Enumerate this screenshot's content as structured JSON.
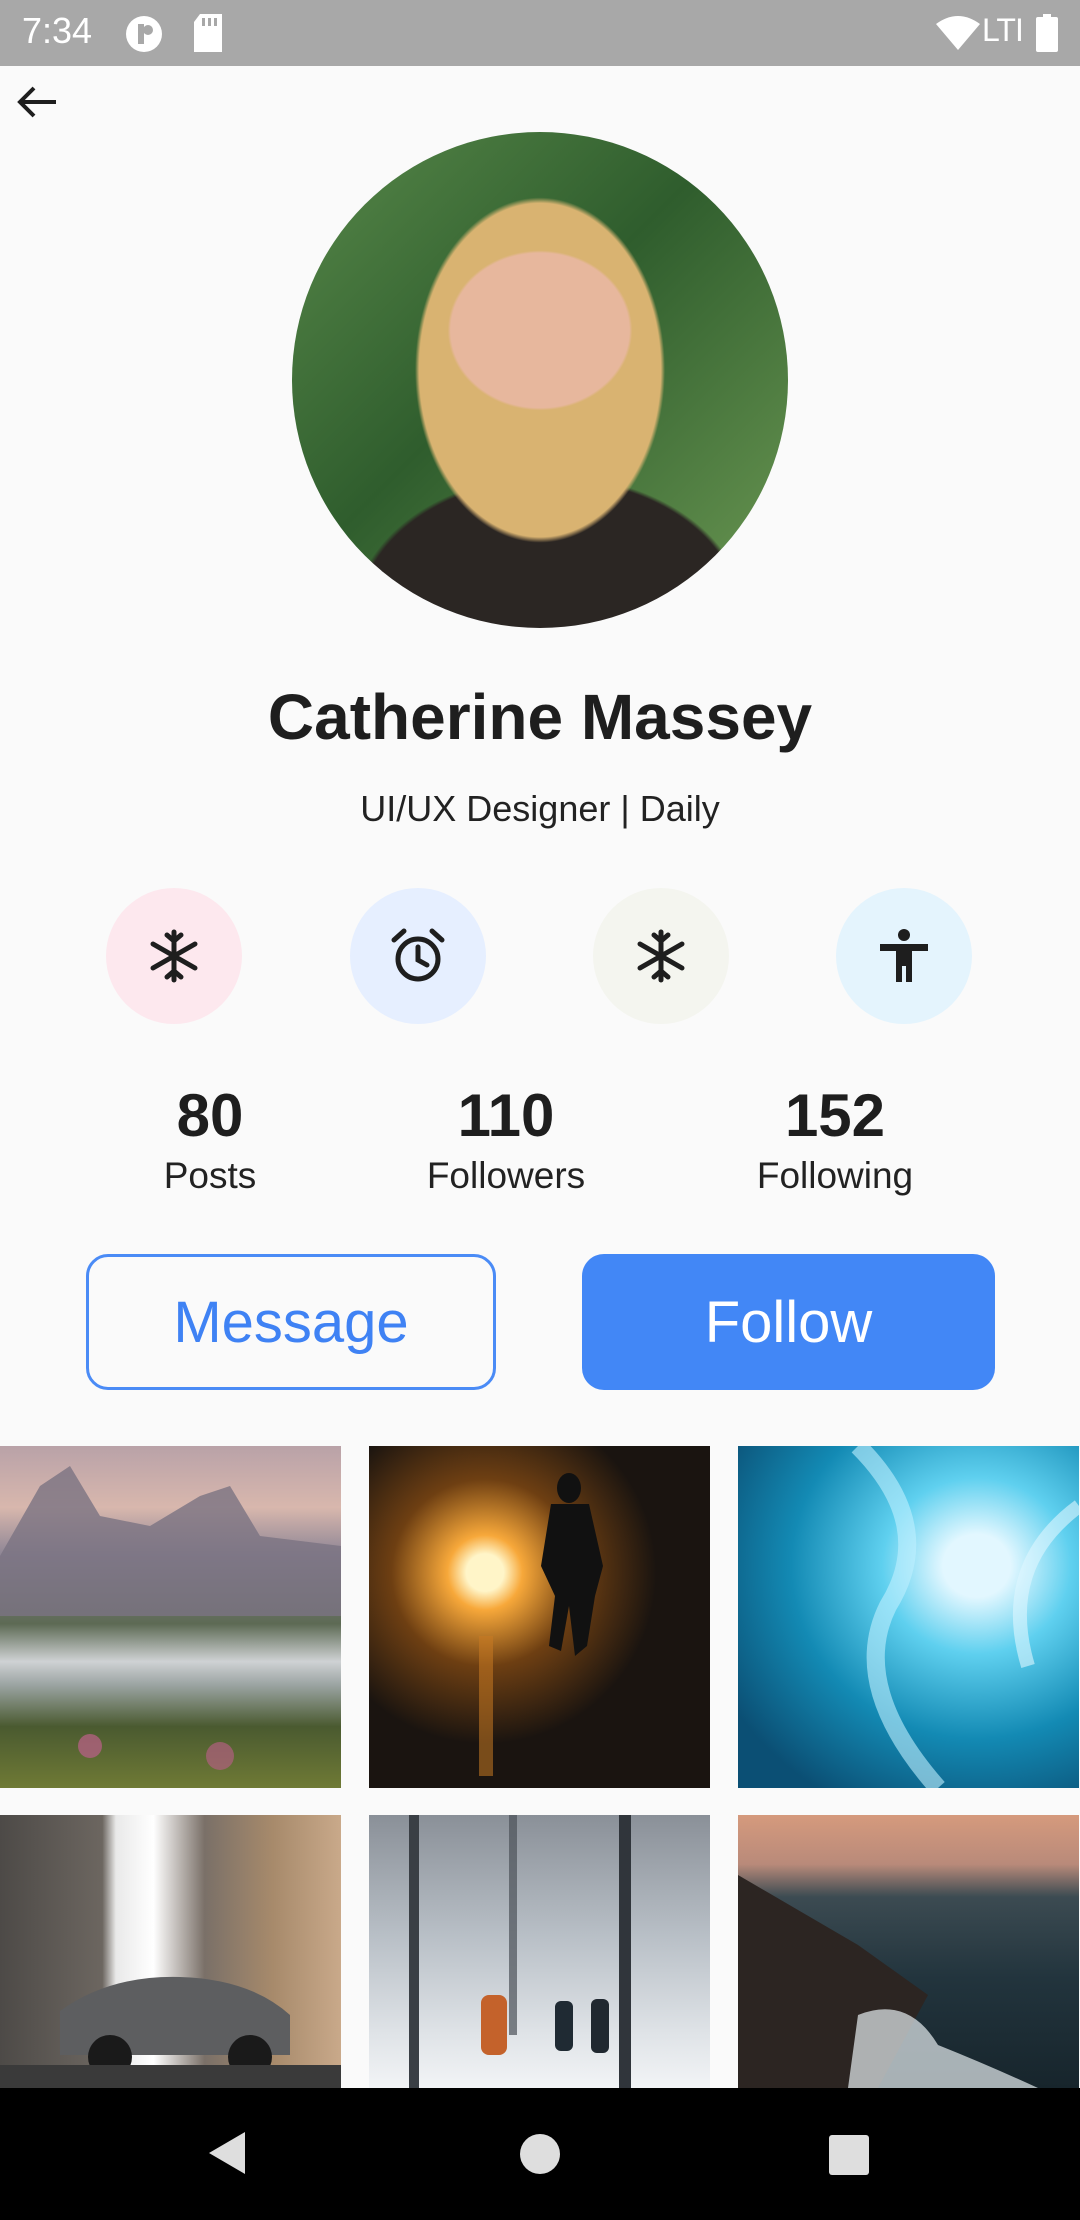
{
  "status_bar": {
    "time": "7:34",
    "network": "LTI"
  },
  "profile": {
    "name": "Catherine Massey",
    "subtitle": "UI/UX Designer | Daily"
  },
  "features": [
    {
      "icon": "snowflake-icon",
      "bg": "#fde8ee"
    },
    {
      "icon": "alarm-clock-icon",
      "bg": "#e6efff"
    },
    {
      "icon": "snowflake-icon",
      "bg": "#f4f5ef"
    },
    {
      "icon": "accessibility-person-icon",
      "bg": "#e4f4fd"
    }
  ],
  "stats": {
    "posts": {
      "value": "80",
      "label": "Posts"
    },
    "followers": {
      "value": "110",
      "label": "Followers"
    },
    "following": {
      "value": "152",
      "label": "Following"
    }
  },
  "actions": {
    "message_label": "Message",
    "follow_label": "Follow"
  },
  "colors": {
    "accent": "#4287f6",
    "background": "#fafafa",
    "status_bar": "#a8a8a8",
    "nav_bar": "#000000"
  }
}
